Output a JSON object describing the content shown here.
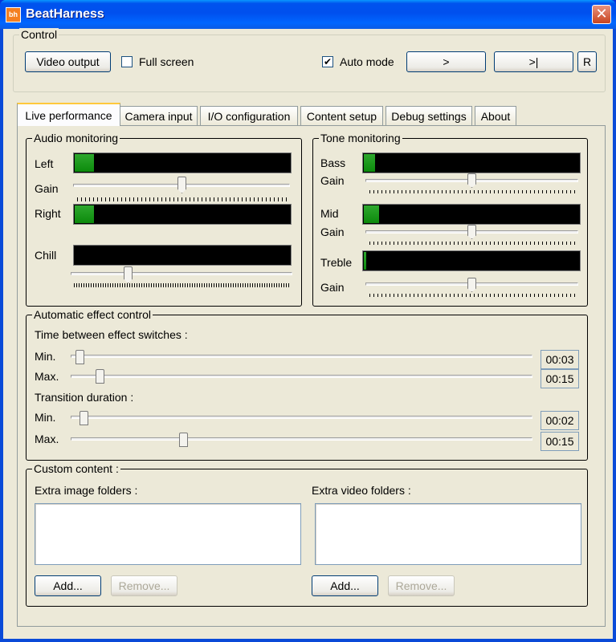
{
  "window": {
    "title": "BeatHarness",
    "icon_text": "bh"
  },
  "control": {
    "label": "Control",
    "video_output": "Video output",
    "full_screen": "Full screen",
    "full_screen_checked": false,
    "auto_mode": "Auto mode",
    "auto_mode_checked": true,
    "next": ">",
    "next_end": ">|",
    "reset": "R"
  },
  "tabs": [
    {
      "label": "Live performance",
      "active": true
    },
    {
      "label": "Camera input"
    },
    {
      "label": "I/O configuration"
    },
    {
      "label": "Content setup"
    },
    {
      "label": "Debug settings"
    },
    {
      "label": "About"
    }
  ],
  "audio": {
    "label": "Audio monitoring",
    "left": "Left",
    "gain": "Gain",
    "right": "Right",
    "chill": "Chill",
    "left_level": 0.09,
    "right_level": 0.09,
    "chill_level": 0.0,
    "gain_value": 0.5,
    "chill_slider": 0.25
  },
  "tone": {
    "label": "Tone monitoring",
    "bass": "Bass",
    "mid": "Mid",
    "treble": "Treble",
    "gain": "Gain",
    "bass_level": 0.05,
    "mid_level": 0.07,
    "treble_level": 0.01,
    "bass_gain": 0.5,
    "mid_gain": 0.5,
    "treble_gain": 0.5
  },
  "auto_effect": {
    "label": "Automatic effect control",
    "time_between": "Time between effect switches :",
    "transition": "Transition duration :",
    "min": "Min.",
    "max": "Max.",
    "switch_min": "00:03",
    "switch_max": "00:15",
    "trans_min": "00:02",
    "trans_max": "00:15",
    "switch_min_pos": 0.01,
    "switch_max_pos": 0.055,
    "trans_min_pos": 0.02,
    "trans_max_pos": 0.24
  },
  "custom": {
    "label": "Custom content :",
    "image_folders": "Extra image folders :",
    "video_folders": "Extra video folders :",
    "add": "Add...",
    "remove": "Remove..."
  }
}
